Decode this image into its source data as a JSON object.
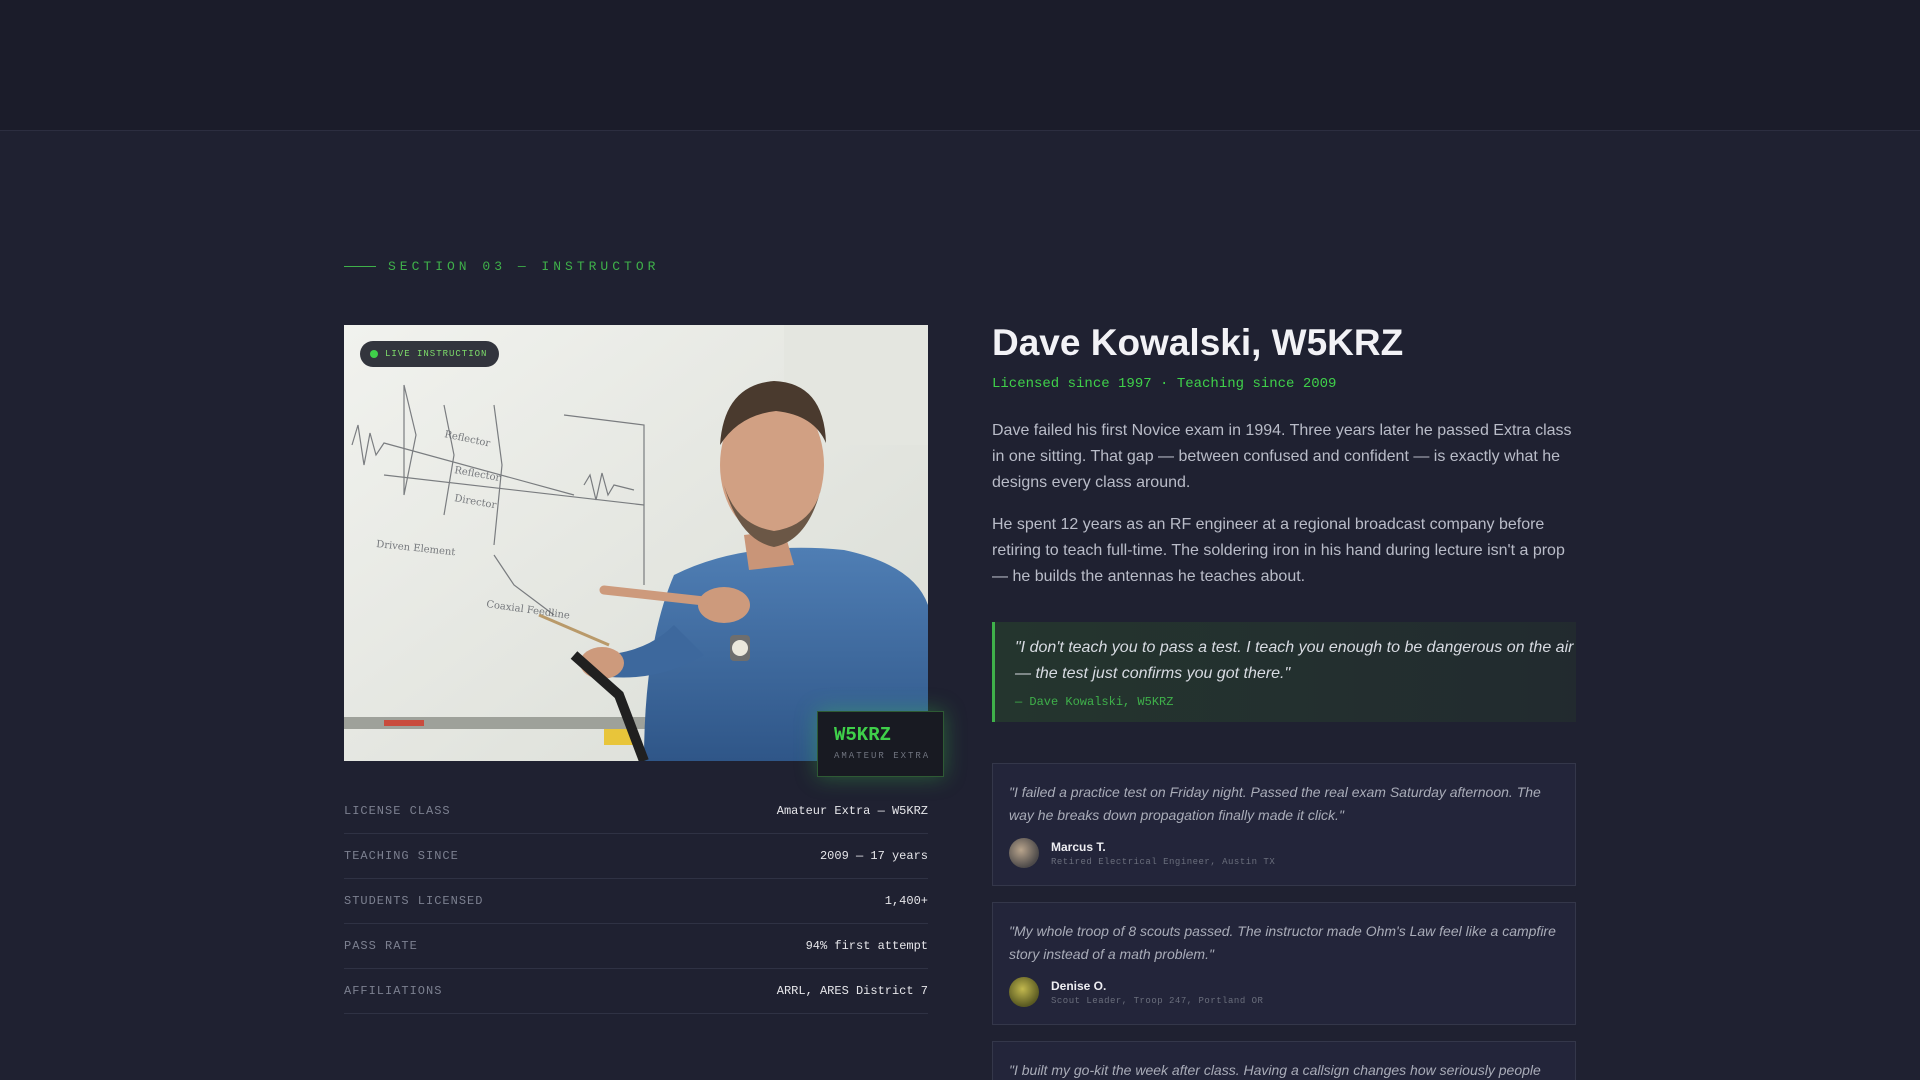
{
  "section": {
    "label": "SECTION 03 — INSTRUCTOR"
  },
  "photo": {
    "live_badge": "LIVE INSTRUCTION",
    "whiteboard_labels": [
      "Reflector",
      "Reflector",
      "Director",
      "Driven Element",
      "Coaxial Feedline"
    ]
  },
  "callsign_badge": {
    "sign": "W5KRZ",
    "class": "AMATEUR EXTRA"
  },
  "facts": [
    {
      "key": "LICENSE CLASS",
      "value": "Amateur Extra — W5KRZ"
    },
    {
      "key": "TEACHING SINCE",
      "value": "2009 — 17 years"
    },
    {
      "key": "STUDENTS LICENSED",
      "value": "1,400+"
    },
    {
      "key": "PASS RATE",
      "value": "94% first attempt"
    },
    {
      "key": "AFFILIATIONS",
      "value": "ARRL, ARES District 7"
    }
  ],
  "instructor": {
    "name": "Dave Kowalski, W5KRZ",
    "since": "Licensed since 1997 · Teaching since 2009",
    "bio": [
      "Dave failed his first Novice exam in 1994. Three years later he passed Extra class in one sitting. That gap — between confused and confident — is exactly what he designs every class around.",
      "He spent 12 years as an RF engineer at a regional broadcast company before retiring to teach full-time. The soldering iron in his hand during lecture isn't a prop — he builds the antennas he teaches about."
    ]
  },
  "quote": {
    "text": "\"I don't teach you to pass a test. I teach you enough to be dangerous on the air — the test just confirms you got there.\"",
    "attribution": "— Dave Kowalski, W5KRZ"
  },
  "testimonials": [
    {
      "quote": "\"I failed a practice test on Friday night. Passed the real exam Saturday afternoon. The way he breaks down propagation finally made it click.\"",
      "name": "Marcus T.",
      "role": "Retired Electrical Engineer, Austin TX"
    },
    {
      "quote": "\"My whole troop of 8 scouts passed. The instructor made Ohm's Law feel like a campfire story instead of a math problem.\"",
      "name": "Denise O.",
      "role": "Scout Leader, Troop 247, Portland OR"
    },
    {
      "quote": "\"I built my go-kit the week after class. Having a callsign changes how seriously people",
      "name": "",
      "role": ""
    }
  ],
  "colors": {
    "accent": "#3fd04a",
    "background": "#1f2131",
    "topbar": "#1b1c2a"
  }
}
